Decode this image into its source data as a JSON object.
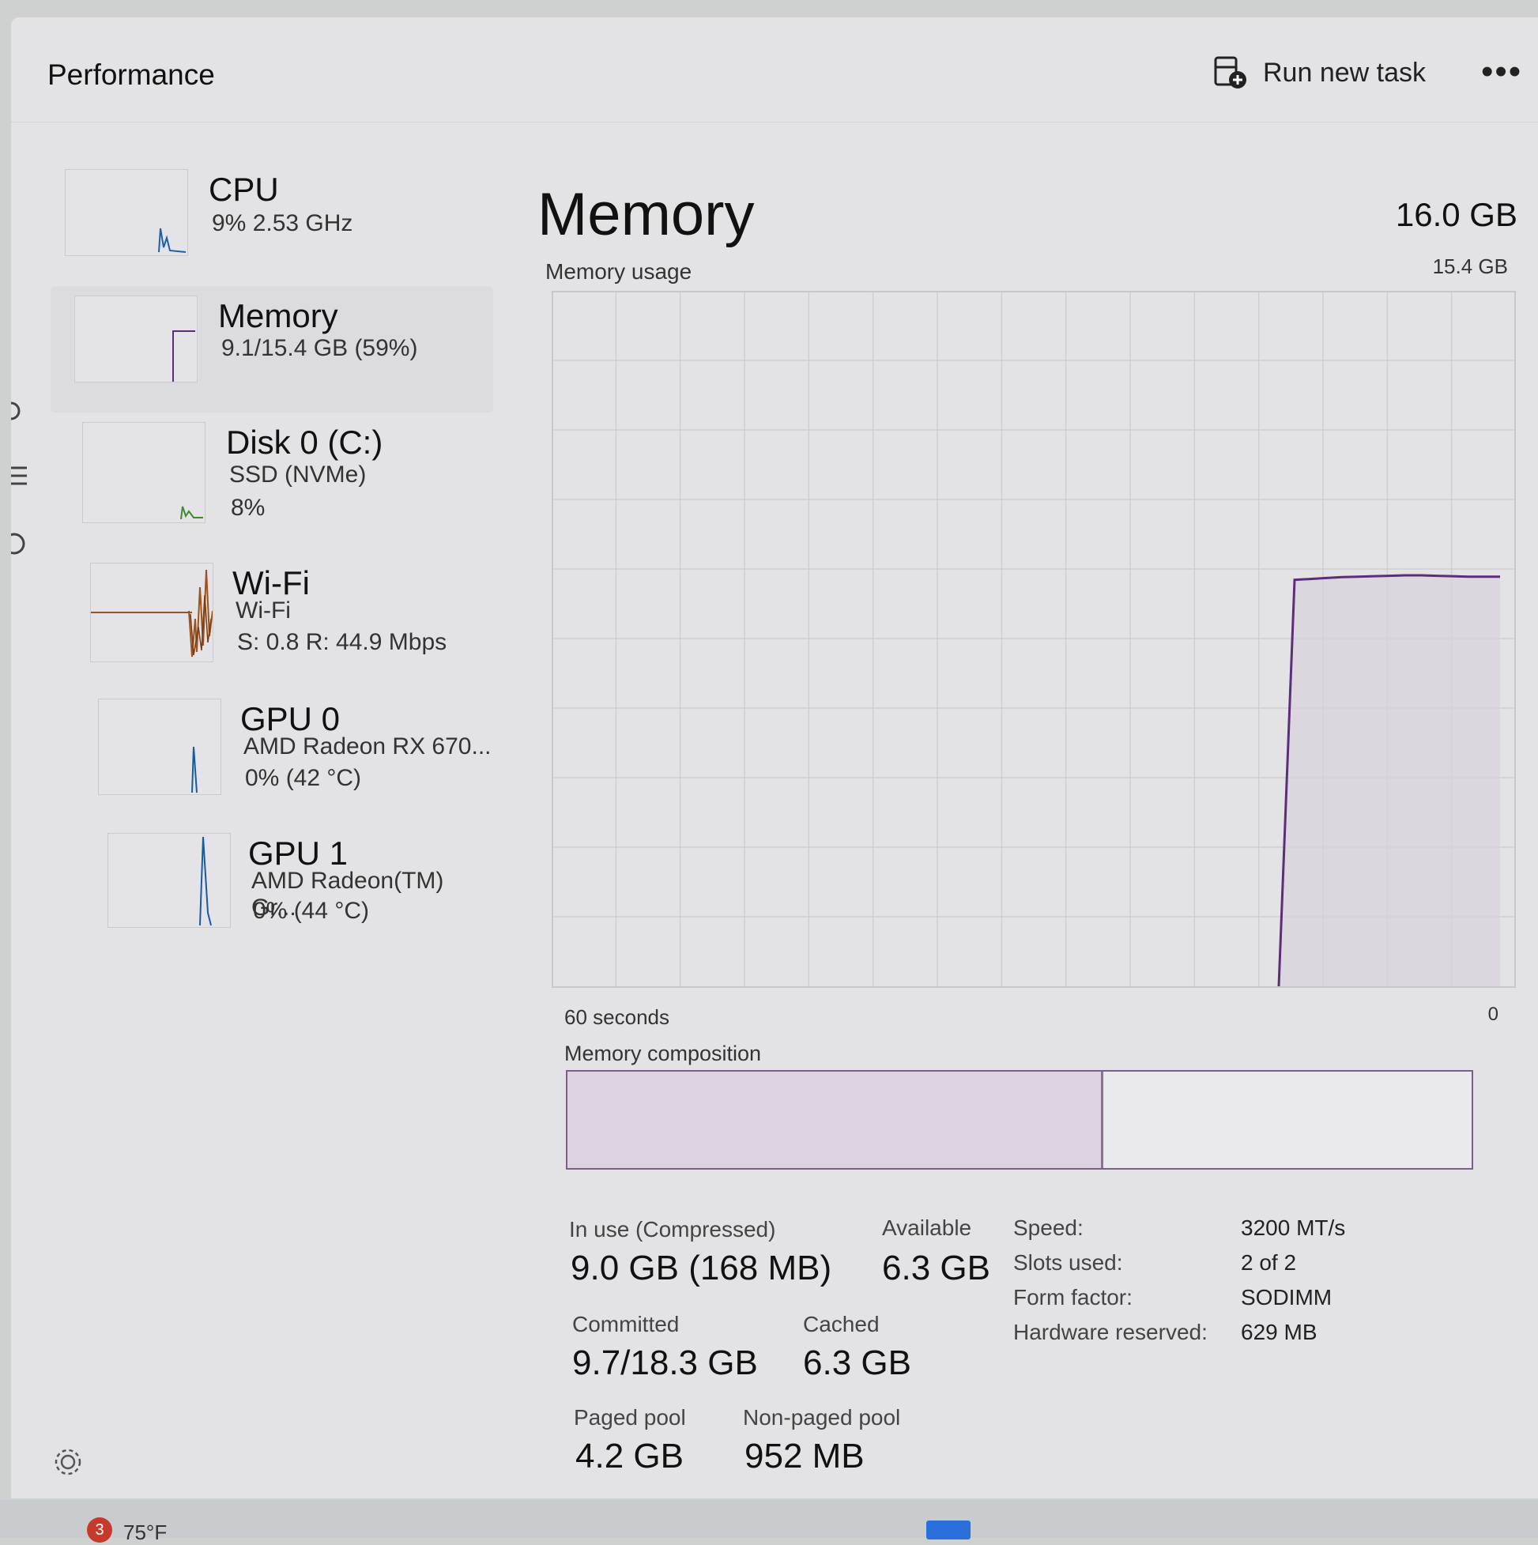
{
  "header": {
    "title": "Performance",
    "run_task_label": "Run new task",
    "more_label": "•••"
  },
  "sidebar": {
    "items": [
      {
        "name": "CPU",
        "line1": "9%  2.53 GHz",
        "line2": "",
        "color": "#1f5fa8",
        "icon": "cpu-spark"
      },
      {
        "name": "Memory",
        "line1": "9.1/15.4 GB (59%)",
        "line2": "",
        "color": "#5c2d78",
        "icon": "memory-spark"
      },
      {
        "name": "Disk 0 (C:)",
        "line1": "SSD (NVMe)",
        "line2": "8%",
        "color": "#3f8a2a",
        "icon": "disk-spark"
      },
      {
        "name": "Wi-Fi",
        "line1": "Wi-Fi",
        "line2": "S: 0.8  R: 44.9 Mbps",
        "color": "#a0521c",
        "icon": "wifi-spark"
      },
      {
        "name": "GPU 0",
        "line1": "AMD Radeon RX 670...",
        "line2": "0%  (42 °C)",
        "color": "#1a5aa0",
        "icon": "gpu-spark"
      },
      {
        "name": "GPU 1",
        "line1": "AMD Radeon(TM) Gr...",
        "line2": "0%  (44 °C)",
        "color": "#1a5aa0",
        "icon": "gpu-spark"
      }
    ]
  },
  "main": {
    "title": "Memory",
    "total": "16.0 GB",
    "usage_label": "Memory usage",
    "usage_max": "15.4 GB",
    "x_left": "60 seconds",
    "x_right": "0",
    "composition_label": "Memory composition",
    "composition_in_use_fraction": 0.59,
    "stats": {
      "in_use_label": "In use (Compressed)",
      "in_use_value": "9.0 GB (168 MB)",
      "available_label": "Available",
      "available_value": "6.3 GB",
      "committed_label": "Committed",
      "committed_value": "9.7/18.3 GB",
      "cached_label": "Cached",
      "cached_value": "6.3 GB",
      "paged_label": "Paged pool",
      "paged_value": "4.2 GB",
      "nonpaged_label": "Non-paged pool",
      "nonpaged_value": "952 MB"
    },
    "specs": [
      {
        "label": "Speed:",
        "value": "3200 MT/s"
      },
      {
        "label": "Slots used:",
        "value": "2 of 2"
      },
      {
        "label": "Form factor:",
        "value": "SODIMM"
      },
      {
        "label": "Hardware reserved:",
        "value": "629 MB"
      }
    ],
    "accent": "#5c2d78"
  },
  "chart_data": {
    "type": "area",
    "x": [
      60,
      59,
      58,
      57,
      56,
      55,
      54,
      53,
      52,
      51,
      50,
      49,
      48,
      47,
      46,
      45,
      44,
      43,
      42,
      41,
      40,
      39,
      38,
      37,
      36,
      35,
      34,
      33,
      32,
      31,
      30,
      29,
      28,
      27,
      26,
      25,
      24,
      23,
      22,
      21,
      20,
      19,
      18,
      17,
      16,
      15,
      14,
      13,
      12,
      11,
      10,
      9,
      8,
      7,
      6,
      5,
      4,
      3,
      2,
      1,
      0
    ],
    "values": [
      null,
      null,
      null,
      null,
      null,
      null,
      null,
      null,
      null,
      null,
      null,
      null,
      null,
      null,
      null,
      null,
      null,
      null,
      null,
      null,
      null,
      null,
      null,
      null,
      null,
      null,
      null,
      null,
      null,
      null,
      null,
      null,
      null,
      null,
      null,
      null,
      null,
      null,
      null,
      null,
      null,
      null,
      null,
      null,
      null,
      null,
      0,
      9.0,
      9.02,
      9.04,
      9.06,
      9.07,
      9.08,
      9.09,
      9.1,
      9.1,
      9.09,
      9.08,
      9.07,
      9.07,
      9.07
    ],
    "ylim": [
      0,
      15.4
    ],
    "grid": true,
    "xlabel": "60 seconds",
    "title": "Memory usage"
  },
  "taskbar": {
    "badge": "3",
    "temp": "75°F"
  }
}
